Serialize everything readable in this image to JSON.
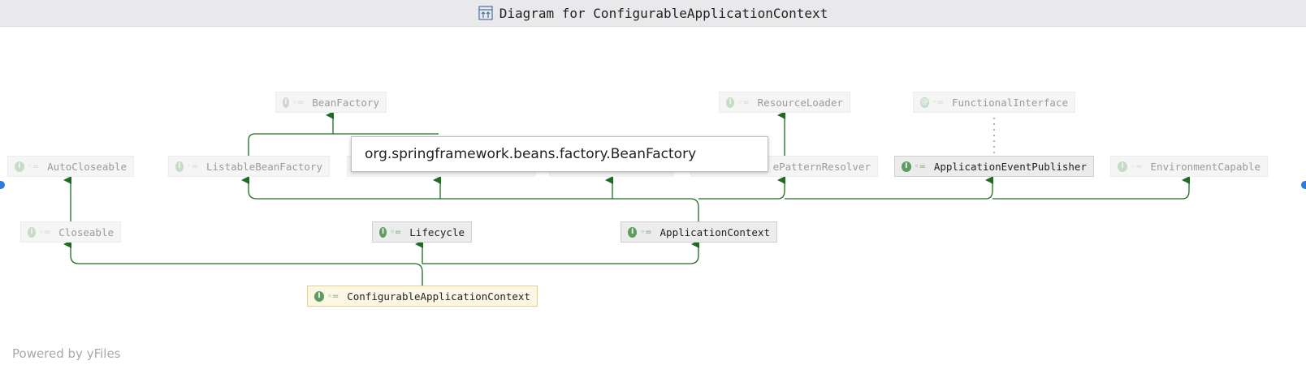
{
  "window": {
    "title": "Diagram for ConfigurableApplicationContext"
  },
  "nodes": {
    "bean_factory": "BeanFactory",
    "resource_loader": "ResourceLoader",
    "functional_interface": "FunctionalInterface",
    "auto_closeable": "AutoCloseable",
    "listable_bean_factory": "ListableBeanFactory",
    "resource_pattern_resolver": "ePatternResolver",
    "application_event_publisher": "ApplicationEventPublisher",
    "environment_capable": "EnvironmentCapable",
    "closeable": "Closeable",
    "lifecycle": "Lifecycle",
    "application_context": "ApplicationContext",
    "configurable_application_context": "ConfigurableApplicationContext"
  },
  "tooltip": {
    "text": "org.springframework.beans.factory.BeanFactory"
  },
  "footer": {
    "powered_by": "Powered by yFiles"
  },
  "icons": {
    "interface_badge": "I",
    "access_modifier": "public-access-icon"
  },
  "colors": {
    "edge": "#1f6b1f",
    "node_selected_border": "#e7cf86",
    "badge": "#5f9c5f"
  }
}
